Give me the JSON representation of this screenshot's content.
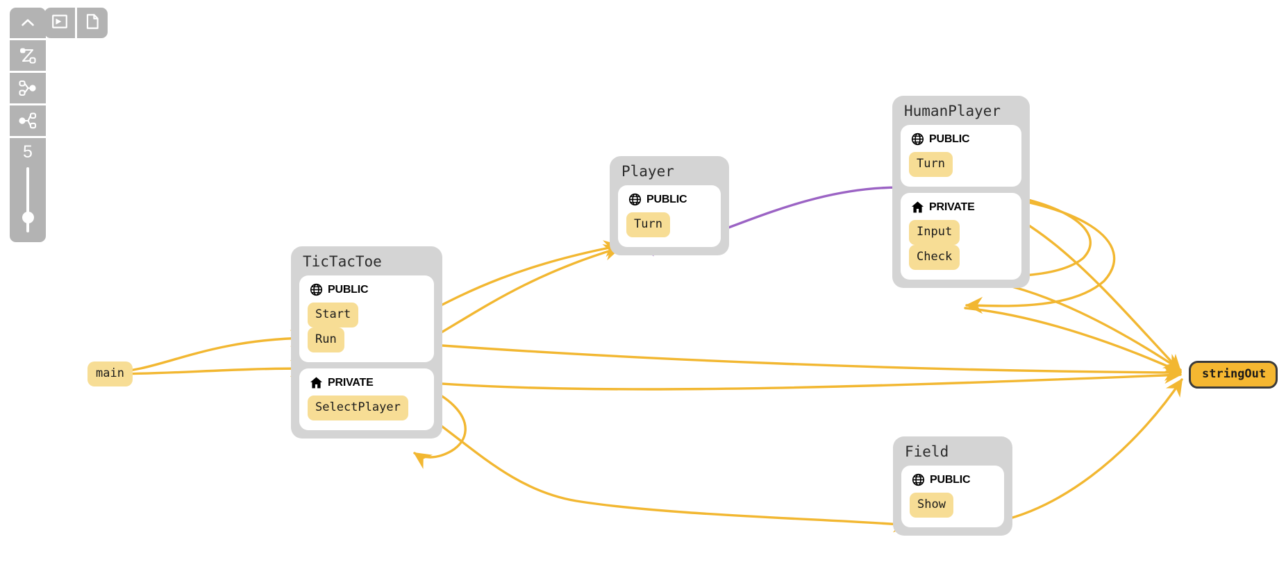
{
  "toolbar": {
    "collapse_label": "collapse-panel",
    "buttons": [
      {
        "name": "collapse-panel-button",
        "icon": "chevron-up-icon"
      },
      {
        "name": "graph-layout-button",
        "icon": "node-link-layout-icon"
      },
      {
        "name": "expand-tree-button",
        "icon": "tree-expand-icon"
      },
      {
        "name": "share-graph-button",
        "icon": "share-nodes-icon"
      }
    ],
    "top_buttons": [
      {
        "name": "terminal-button",
        "icon": "terminal-icon"
      },
      {
        "name": "document-button",
        "icon": "document-icon"
      }
    ],
    "zoom": {
      "value": "5",
      "label": "zoom-level"
    }
  },
  "colors": {
    "group_bg": "#d4d4d4",
    "section_bg": "#ffffff",
    "member_bg": "#f7dd95",
    "selected_bg": "#f5b731",
    "edge_orange": "#f2b731",
    "edge_purple": "#9b63c4",
    "toolbar_bg": "#b3b3b3",
    "canvas_bg": "#ffffff"
  },
  "sections": {
    "public_label": "PUBLIC",
    "private_label": "PRIVATE"
  },
  "free_nodes": [
    {
      "id": "main",
      "label": "main",
      "selected": false
    },
    {
      "id": "stringOut",
      "label": "stringOut",
      "selected": true
    }
  ],
  "groups": [
    {
      "id": "tictactoe",
      "title": "TicTacToe",
      "sections": [
        {
          "kind": "public",
          "label": "PUBLIC",
          "members": [
            "Start",
            "Run"
          ]
        },
        {
          "kind": "private",
          "label": "PRIVATE",
          "members": [
            "SelectPlayer"
          ]
        }
      ]
    },
    {
      "id": "player",
      "title": "Player",
      "sections": [
        {
          "kind": "public",
          "label": "PUBLIC",
          "members": [
            "Turn"
          ]
        }
      ]
    },
    {
      "id": "humanplayer",
      "title": "HumanPlayer",
      "sections": [
        {
          "kind": "public",
          "label": "PUBLIC",
          "members": [
            "Turn"
          ]
        },
        {
          "kind": "private",
          "label": "PRIVATE",
          "members": [
            "Input",
            "Check"
          ]
        }
      ]
    },
    {
      "id": "field",
      "title": "Field",
      "sections": [
        {
          "kind": "public",
          "label": "PUBLIC",
          "members": [
            "Show"
          ]
        }
      ]
    }
  ],
  "edges": [
    {
      "from": "main",
      "to": "TicTacToe.Start",
      "color": "orange"
    },
    {
      "from": "main",
      "to": "TicTacToe.Run",
      "color": "orange"
    },
    {
      "from": "TicTacToe.Start",
      "to": "Player.Turn",
      "color": "orange"
    },
    {
      "from": "TicTacToe.Run",
      "to": "Player.Turn",
      "color": "orange"
    },
    {
      "from": "TicTacToe.Run",
      "to": "TicTacToe.SelectPlayer",
      "color": "orange"
    },
    {
      "from": "TicTacToe.Run",
      "to": "Field.Show",
      "color": "orange"
    },
    {
      "from": "TicTacToe.Run",
      "to": "stringOut",
      "color": "orange"
    },
    {
      "from": "TicTacToe.Start",
      "to": "stringOut",
      "color": "orange"
    },
    {
      "from": "HumanPlayer.Turn",
      "to": "Player.Turn",
      "color": "purple"
    },
    {
      "from": "HumanPlayer.Turn",
      "to": "HumanPlayer.Input",
      "color": "orange"
    },
    {
      "from": "HumanPlayer.Turn",
      "to": "HumanPlayer.Check",
      "color": "orange"
    },
    {
      "from": "HumanPlayer.Turn",
      "to": "stringOut",
      "color": "orange"
    },
    {
      "from": "HumanPlayer.Input",
      "to": "stringOut",
      "color": "orange"
    },
    {
      "from": "HumanPlayer.Check",
      "to": "stringOut",
      "color": "orange"
    },
    {
      "from": "Field.Show",
      "to": "stringOut",
      "color": "orange"
    }
  ]
}
